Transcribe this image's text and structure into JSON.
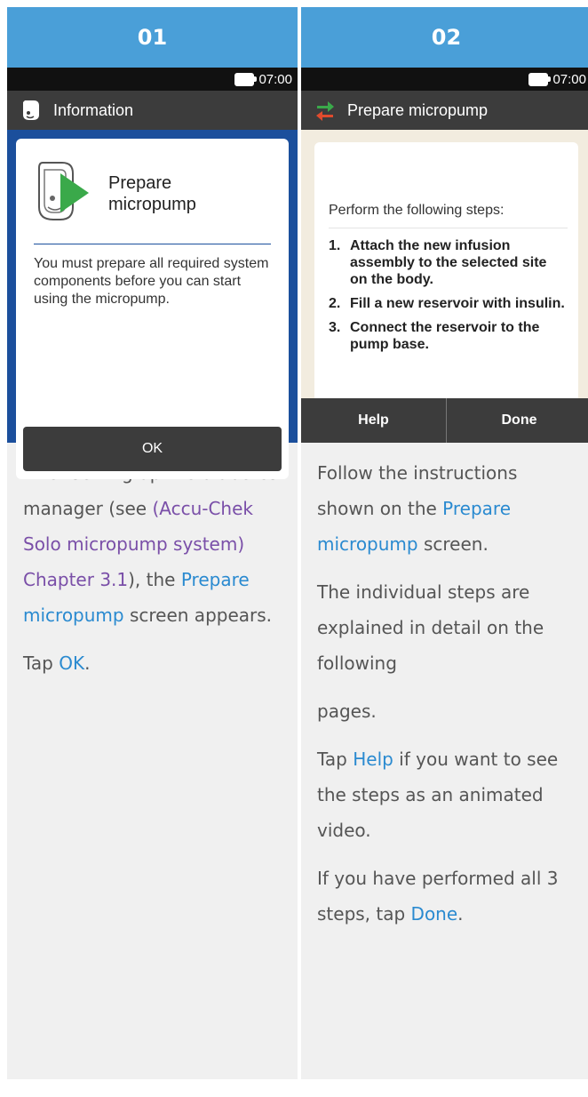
{
  "columns": [
    {
      "number": "01",
      "status_time": "07:00",
      "title_bar": "Information",
      "card": {
        "heading": "Prepare micropump",
        "body": "You must prepare all required system components before you can start using the micropump.",
        "ok_label": "OK"
      },
      "desc": {
        "p1_a": "After setting up the diabetes manager (see ",
        "p1_xref": "(Accu-Chek Solo micropump system) Chapter 3.1",
        "p1_b": "), the ",
        "p1_link": "Prepare micropump",
        "p1_c": " screen appears.",
        "p2_a": "Tap ",
        "p2_link": "OK",
        "p2_b": "."
      }
    },
    {
      "number": "02",
      "status_time": "07:00",
      "title_bar": "Prepare micropump",
      "card": {
        "intro": "Perform the following steps:",
        "steps": [
          {
            "num": "1.",
            "text": "Attach the new infusion assembly to the selected site on the body."
          },
          {
            "num": "2.",
            "text": "Fill a new reservoir with insulin."
          },
          {
            "num": "3.",
            "text": "Connect the reservoir to the pump base."
          }
        ]
      },
      "buttons": {
        "help": "Help",
        "done": "Done"
      },
      "desc": {
        "p1_a": "Follow the instructions shown on the ",
        "p1_link": "Prepare micropump",
        "p1_b": " screen.",
        "p2": "The individual steps are explained in detail on the following",
        "p3": "pages.",
        "p4_a": "Tap ",
        "p4_link": "Help",
        "p4_b": " if you want to see the steps as an animated video.",
        "p5_a": "If you have performed all 3 steps, tap ",
        "p5_link": "Done",
        "p5_b": "."
      }
    }
  ],
  "colors": {
    "header_blue": "#4a9fd8",
    "screen_blue": "#1b4f9c",
    "link": "#2a8ad0",
    "xref": "#7a4fa8"
  },
  "icons": [
    "battery-icon",
    "micropump-info-icon",
    "micropump-play-icon",
    "swap-arrows-icon"
  ]
}
